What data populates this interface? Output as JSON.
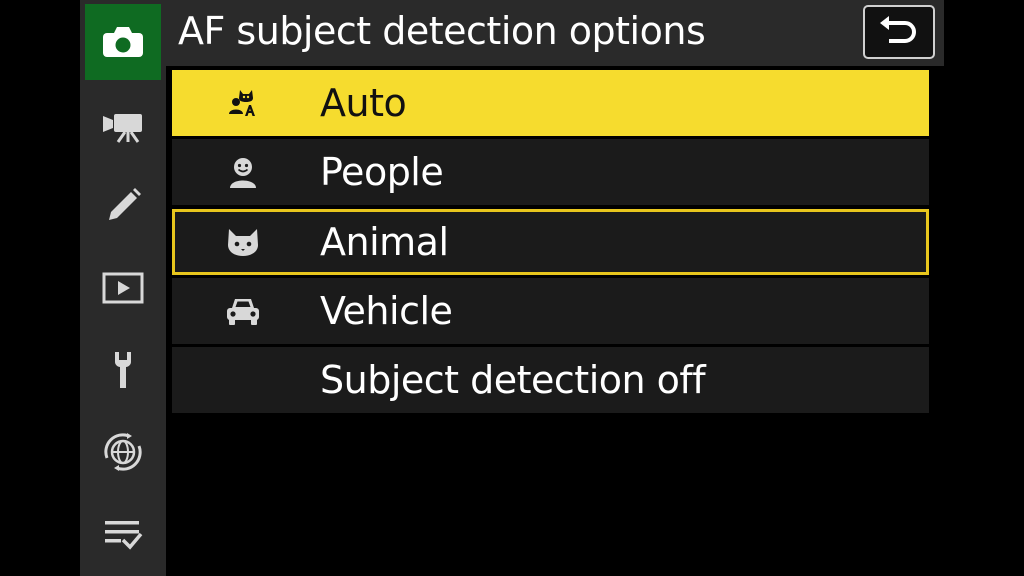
{
  "header": {
    "title": "AF subject detection options"
  },
  "sidebar": {
    "tabs": [
      {
        "name": "photo-shooting-menu",
        "icon": "camera-icon"
      },
      {
        "name": "video-recording-menu",
        "icon": "movie-camera-icon"
      },
      {
        "name": "custom-settings-menu",
        "icon": "pencil-icon"
      },
      {
        "name": "playback-menu",
        "icon": "play-icon"
      },
      {
        "name": "setup-menu",
        "icon": "wrench-icon"
      },
      {
        "name": "network-menu",
        "icon": "globe-network-icon"
      },
      {
        "name": "my-menu",
        "icon": "list-check-icon"
      }
    ]
  },
  "options": [
    {
      "label": "Auto",
      "icon": "auto-subject-icon",
      "state": "highlighted"
    },
    {
      "label": "People",
      "icon": "person-face-icon",
      "state": "current"
    },
    {
      "label": "Animal",
      "icon": "animal-face-icon",
      "state": "current-setting"
    },
    {
      "label": "Vehicle",
      "icon": "car-icon",
      "state": "normal"
    },
    {
      "label": "Subject detection off",
      "icon": "",
      "state": "normal"
    }
  ],
  "colors": {
    "highlight": "#f6dc2e",
    "active_tab": "#0f6b22",
    "outline": "#e8c61d"
  }
}
